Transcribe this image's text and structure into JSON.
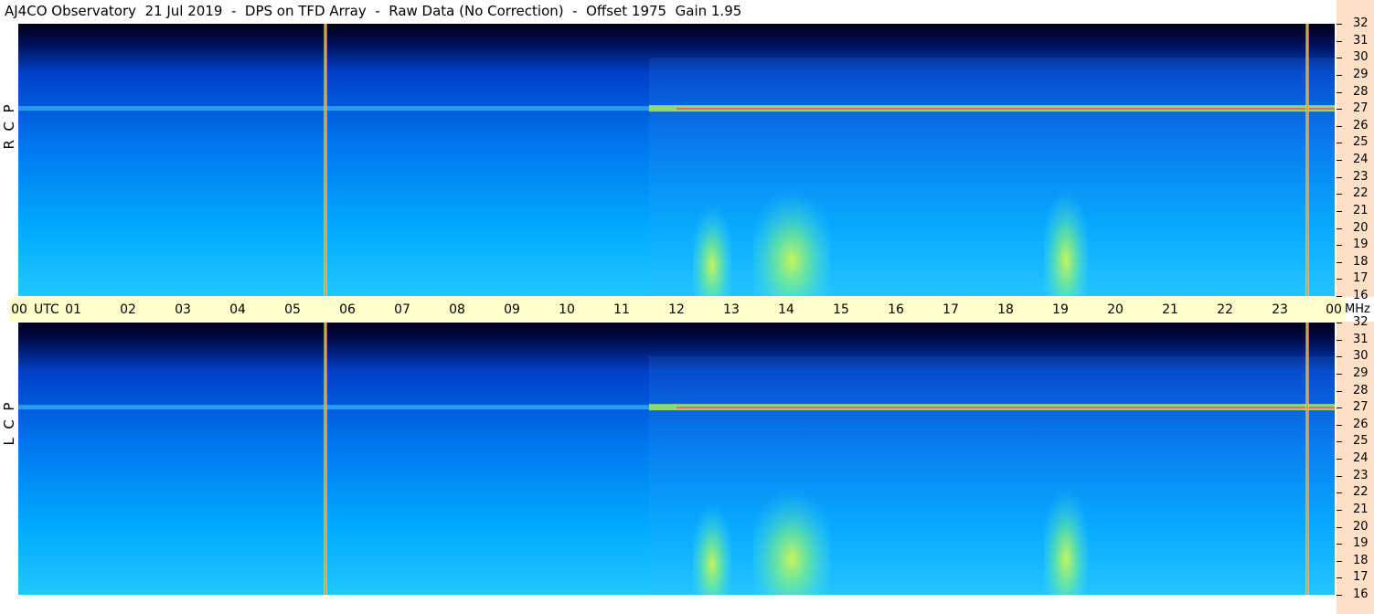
{
  "title": "AJ4CO Observatory  21 Jul 2019  -  DPS on TFD Array  -  Raw Data (No Correction)  -  Offset 1975  Gain 1.95",
  "panels": [
    {
      "id": "rcp",
      "label": "R  C  P"
    },
    {
      "id": "lcp",
      "label": "L  C  P"
    }
  ],
  "chart_data": {
    "type": "heatmap",
    "title": "AJ4CO Observatory  21 Jul 2019  -  DPS on TFD Array  -  Raw Data (No Correction)  -  Offset 1975  Gain 1.95",
    "x_labels": [
      "00",
      "01",
      "02",
      "03",
      "04",
      "05",
      "06",
      "07",
      "08",
      "09",
      "10",
      "11",
      "12",
      "13",
      "14",
      "15",
      "16",
      "17",
      "18",
      "19",
      "20",
      "21",
      "22",
      "23",
      "00"
    ],
    "x_unit": "UTC",
    "xlim": [
      0,
      24
    ],
    "y_labels": [
      "16",
      "17",
      "18",
      "19",
      "20",
      "21",
      "22",
      "23",
      "24",
      "25",
      "26",
      "27",
      "28",
      "29",
      "30",
      "31",
      "32"
    ],
    "y_unit": "MHz",
    "ylim": [
      16,
      32
    ],
    "series": [
      {
        "name": "R  C  P"
      },
      {
        "name": "L  C  P"
      }
    ],
    "features": {
      "vertical_markers_utc": [
        5.6,
        23.5
      ],
      "active_period_utc": [
        11.5,
        24
      ],
      "emission_bursts": [
        {
          "utc": [
            12.3,
            13.0
          ],
          "mhz": [
            16,
            22
          ]
        },
        {
          "utc": [
            13.4,
            14.8
          ],
          "mhz": [
            16,
            23
          ]
        },
        {
          "utc": [
            18.7,
            19.5
          ],
          "mhz": [
            16,
            23
          ]
        }
      ],
      "persistent_band_mhz": 27
    }
  }
}
